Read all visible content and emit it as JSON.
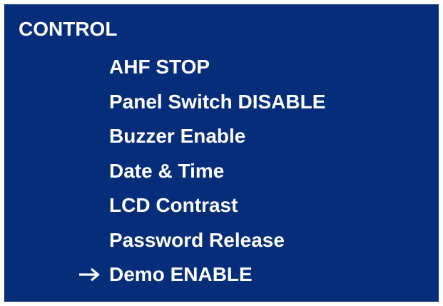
{
  "menu_title": "CONTROL",
  "items": [
    {
      "label": "AHF STOP",
      "selected": false
    },
    {
      "label": "Panel Switch DISABLE",
      "selected": false
    },
    {
      "label": "Buzzer Enable",
      "selected": false
    },
    {
      "label": "Date & Time",
      "selected": false
    },
    {
      "label": "LCD Contrast",
      "selected": false
    },
    {
      "label": "Password Release",
      "selected": false
    },
    {
      "label": "Demo ENABLE",
      "selected": true
    }
  ],
  "colors": {
    "panel_background": "#062D7A",
    "text": "#FFFFFF"
  },
  "selection_indicator_icon": "right-arrow-icon"
}
